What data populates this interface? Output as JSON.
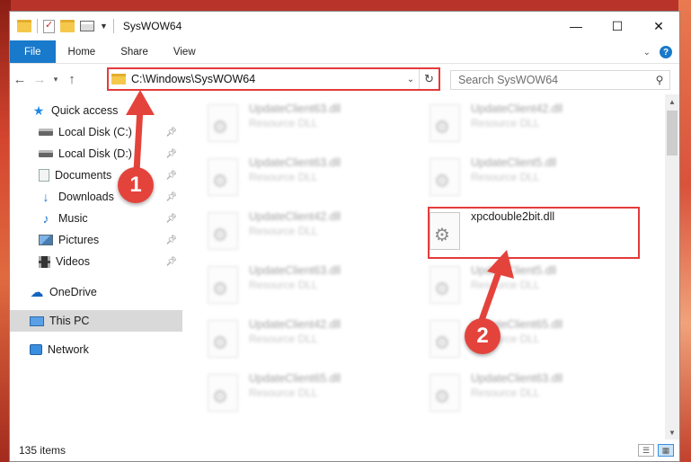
{
  "window": {
    "title": "SysWOW64",
    "controls": {
      "minimize": "—",
      "maximize": "☐",
      "close": "✕"
    }
  },
  "ribbon": {
    "tabs": [
      {
        "label": "File"
      },
      {
        "label": "Home"
      },
      {
        "label": "Share"
      },
      {
        "label": "View"
      }
    ]
  },
  "address": {
    "path": "C:\\Windows\\SysWOW64"
  },
  "search": {
    "placeholder": "Search SysWOW64"
  },
  "navpane": {
    "quick_access": "Quick access",
    "items": [
      {
        "label": "Local Disk (C:)",
        "icon": "disk-icon",
        "pinned": true
      },
      {
        "label": "Local Disk (D:)",
        "icon": "disk-icon",
        "pinned": true
      },
      {
        "label": "Documents",
        "icon": "documents-icon",
        "pinned": true
      },
      {
        "label": "Downloads",
        "icon": "downloads-icon",
        "pinned": true
      },
      {
        "label": "Music",
        "icon": "music-icon",
        "pinned": true
      },
      {
        "label": "Pictures",
        "icon": "pictures-icon",
        "pinned": true
      },
      {
        "label": "Videos",
        "icon": "videos-icon",
        "pinned": true
      }
    ],
    "onedrive": "OneDrive",
    "this_pc": "This PC",
    "network": "Network"
  },
  "files": [
    {
      "name": "UpdateClient63.dll",
      "type": "Resource DLL",
      "blurred": true
    },
    {
      "name": "UpdateClient42.dll",
      "type": "Resource DLL",
      "blurred": true
    },
    {
      "name": "UpdateClient63.dll",
      "type": "Resource DLL",
      "blurred": true
    },
    {
      "name": "UpdateClient5.dll",
      "type": "Resource DLL",
      "blurred": true
    },
    {
      "name": "UpdateClient42.dll",
      "type": "Resource DLL",
      "blurred": true
    },
    {
      "name": "xpcdouble2bit.dll",
      "type": "",
      "blurred": false
    },
    {
      "name": "UpdateClient63.dll",
      "type": "Resource DLL",
      "blurred": true
    },
    {
      "name": "UpdateClient5.dll",
      "type": "Resource DLL",
      "blurred": true
    },
    {
      "name": "UpdateClient42.dll",
      "type": "Resource DLL",
      "blurred": true
    },
    {
      "name": "UpdateClient65.dll",
      "type": "Resource DLL",
      "blurred": true
    },
    {
      "name": "UpdateClient65.dll",
      "type": "Resource DLL",
      "blurred": true
    },
    {
      "name": "UpdateClient63.dll",
      "type": "Resource DLL",
      "blurred": true
    }
  ],
  "status": {
    "item_count": "135 items"
  },
  "annotations": {
    "step1": "1",
    "step2": "2",
    "color": "#e4433c"
  }
}
